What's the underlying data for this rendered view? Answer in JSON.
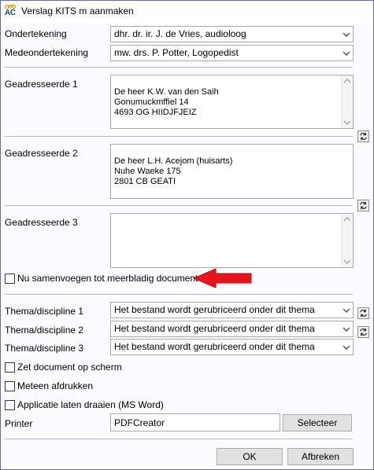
{
  "window": {
    "title": "Verslag KITS m aanmaken",
    "icon": {
      "top": "OPD",
      "bottom": "AC"
    }
  },
  "ondertekening": {
    "label": "Ondertekening",
    "value": "dhr. dr. ir. J. de Vries, audioloog"
  },
  "medeondertekening": {
    "label": "Medeondertekening",
    "value": "mw. drs. P. Potter, Logopedist"
  },
  "geadresseerde1": {
    "label": "Geadresseerde 1",
    "value": "De heer K.W. van den Saih\nGonumuckmffiel 14\n4693 OG  HIIDJFJEIZ"
  },
  "geadresseerde2": {
    "label": "Geadresseerde 2",
    "value": "De heer L.H. Acejom (huisarts)\nNuhe Waeke 175\n2801 CB  GEATI"
  },
  "geadresseerde3": {
    "label": "Geadresseerde 3",
    "value": ""
  },
  "samenvoegen": {
    "label": "Nu samenvoegen tot meerbladig document",
    "checked": false
  },
  "themas": [
    {
      "label": "Thema/discipline 1",
      "value": "Het bestand wordt gerubriceerd onder dit thema"
    },
    {
      "label": "Thema/discipline 2",
      "value": "Het bestand wordt gerubriceerd onder dit thema"
    },
    {
      "label": "Thema/discipline 3",
      "value": "Het bestand wordt gerubriceerd onder dit thema"
    }
  ],
  "options": {
    "zet_op_scherm": "Zet document op scherm",
    "meteen_afdrukken": "Meteen afdrukken",
    "applicatie_draaien": "Applicatie laten draaien (MS Word)"
  },
  "printer": {
    "label": "Printer",
    "value": "PDFCreator",
    "select_button": "Selecteer"
  },
  "buttons": {
    "ok": "OK",
    "cancel": "Afbreken"
  },
  "colors": {
    "arrow": "#e8141c",
    "window_border": "#6b6b9a",
    "field_border": "#a9a9a9"
  },
  "icons": {
    "refresh": "refresh-icon",
    "dropdown": "chevron-down-icon"
  }
}
